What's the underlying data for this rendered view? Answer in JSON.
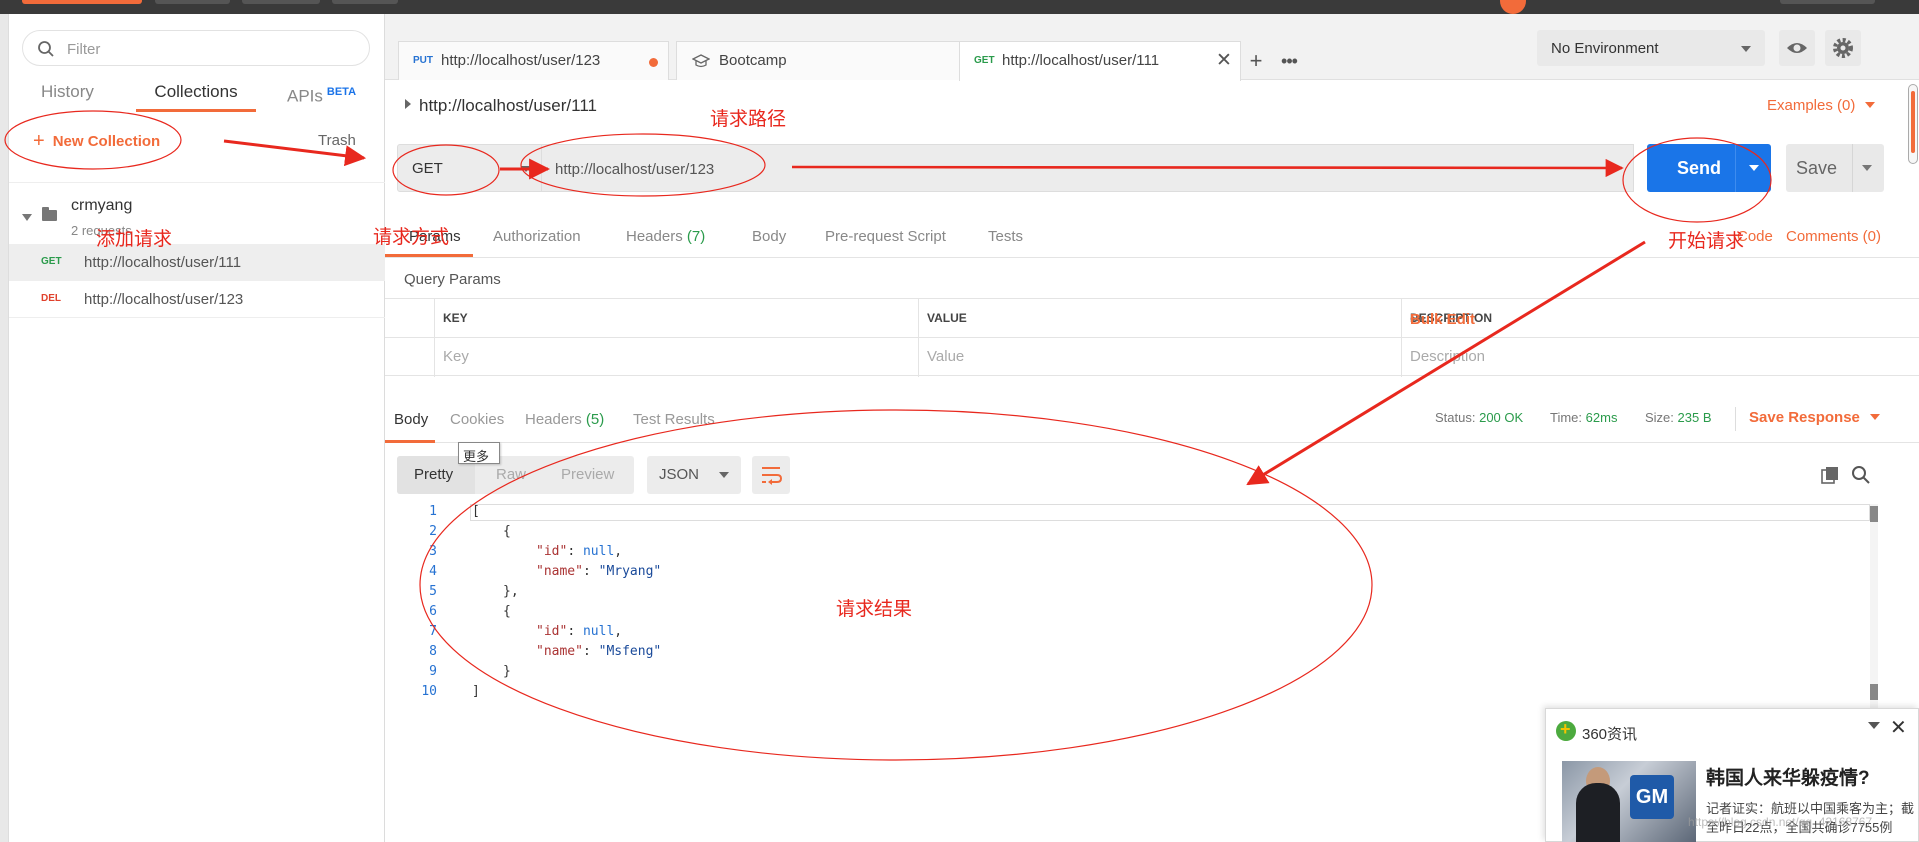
{
  "sidebar": {
    "filter_placeholder": "Filter",
    "tabs": [
      {
        "label": "History"
      },
      {
        "label": "Collections"
      },
      {
        "label": "APIs",
        "badge": "BETA"
      }
    ],
    "new_collection_label": "New Collection",
    "trash_label": "Trash",
    "collection": {
      "name": "crmyang",
      "count": "2 requests"
    },
    "requests": [
      {
        "method": "GET",
        "url": "http://localhost/user/111"
      },
      {
        "method": "DEL",
        "url": "http://localhost/user/123"
      }
    ]
  },
  "tabs": [
    {
      "method": "PUT",
      "title": "http://localhost/user/123"
    },
    {
      "title": "Bootcamp"
    },
    {
      "method": "GET",
      "title": "http://localhost/user/111"
    }
  ],
  "environment": {
    "selected": "No Environment"
  },
  "request": {
    "title": "http://localhost/user/111",
    "examples_label": "Examples (0)",
    "method": "GET",
    "url": "http://localhost/user/123",
    "send_label": "Send",
    "save_label": "Save",
    "subtabs": [
      {
        "label": "Params"
      },
      {
        "label": "Authorization"
      },
      {
        "label": "Headers",
        "count": "(7)"
      },
      {
        "label": "Body"
      },
      {
        "label": "Pre-request Script"
      },
      {
        "label": "Tests"
      }
    ],
    "code_label": "Code",
    "comments_label": "Comments (0)",
    "query_params_title": "Query Params",
    "columns": [
      "KEY",
      "VALUE",
      "DESCRIPTION"
    ],
    "placeholders": [
      "Key",
      "Value",
      "Description"
    ],
    "bulk_edit_label": "Bulk Edit"
  },
  "response": {
    "tabs": [
      {
        "label": "Body"
      },
      {
        "label": "Cookies"
      },
      {
        "label": "Headers",
        "count": "(5)"
      },
      {
        "label": "Test Results"
      }
    ],
    "status_label": "Status:",
    "status_value": "200 OK",
    "time_label": "Time:",
    "time_value": "62ms",
    "size_label": "Size:",
    "size_value": "235 B",
    "save_response_label": "Save Response",
    "tooltip": "更多",
    "formats": [
      "Pretty",
      "Raw",
      "Preview"
    ],
    "language": "JSON",
    "line_numbers": [
      "1",
      "2",
      "3",
      "4",
      "5",
      "6",
      "7",
      "8",
      "9",
      "10"
    ],
    "lines": [
      "[",
      "{",
      "\"id\": null,",
      "\"name\": \"Mryang\"",
      "},",
      "{",
      "\"id\": null,",
      "\"name\": \"Msfeng\"",
      "}",
      "]"
    ]
  },
  "annotations": {
    "add_request": "添加请求",
    "request_path": "请求路径",
    "request_method": "请求方式",
    "start_request": "开始请求",
    "request_result": "请求结果",
    "annotation_color": "#e8281e"
  },
  "popup": {
    "brand": "360资讯",
    "image_text": "GM",
    "headline": "韩国人来华躲疫情?",
    "snippet": "记者证实：航班以中国乘客为主；截至昨日22点，全国共确诊7755例",
    "watermark": "https://blog.csdn.net/qq_42168767"
  },
  "colors": {
    "accent": "#f26b3a",
    "send": "#1a75e8",
    "get": "#2a9b4b",
    "del": "#e0412c",
    "put": "#2672d2"
  }
}
